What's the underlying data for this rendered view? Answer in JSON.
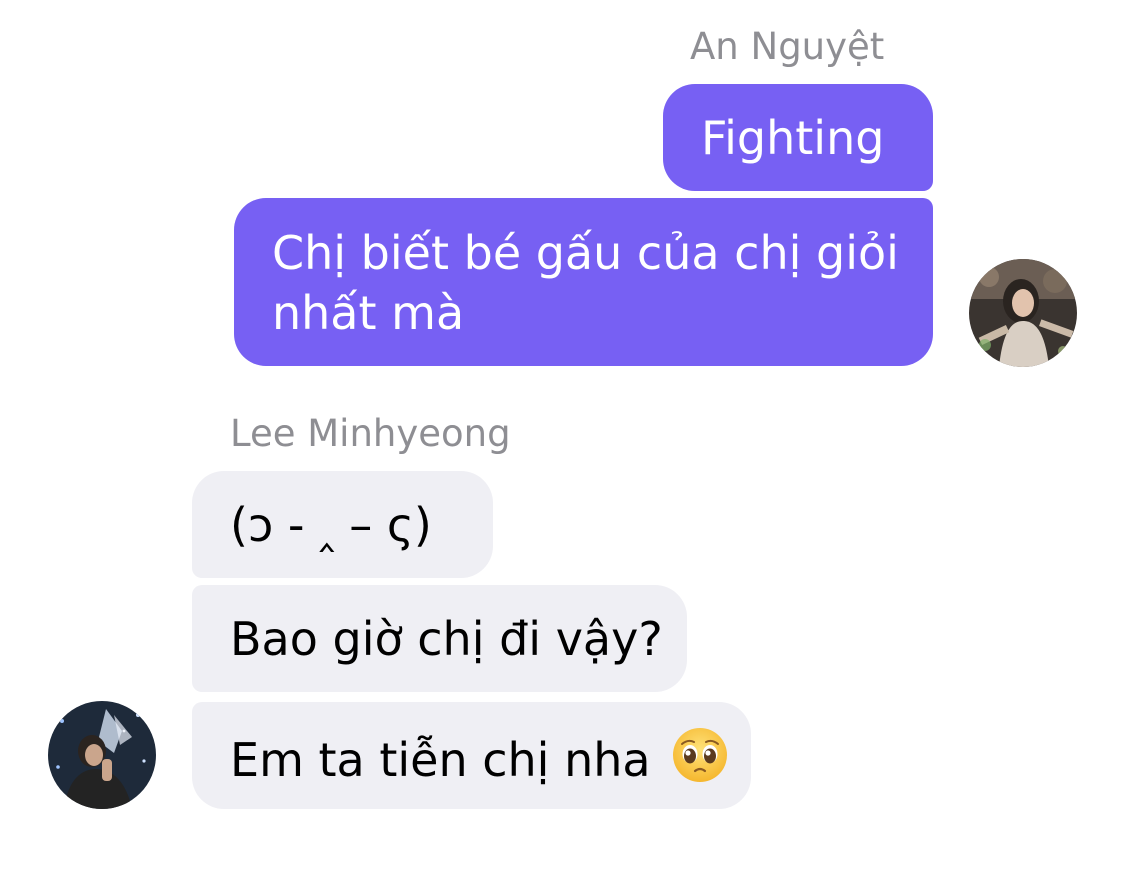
{
  "conversation": {
    "outgoing": {
      "sender_name": "An Nguyệt",
      "messages": [
        {
          "text": "Fighting"
        },
        {
          "line1": "Chị biết bé gấu của chị giỏi",
          "line2": "nhất mà"
        }
      ]
    },
    "incoming": {
      "sender_name": "Lee Minhyeong",
      "messages": [
        {
          "text": "(ɔ - ‸ – ς)"
        },
        {
          "text": "Bao giờ chị đi vậy?"
        },
        {
          "text": "Em ta tiễn chị nha",
          "emoji": "pleading-face-emoji"
        }
      ]
    }
  },
  "colors": {
    "outgoing_bubble": "#7760f3",
    "incoming_bubble": "#efeff4",
    "sender_name": "#8e8e93"
  }
}
